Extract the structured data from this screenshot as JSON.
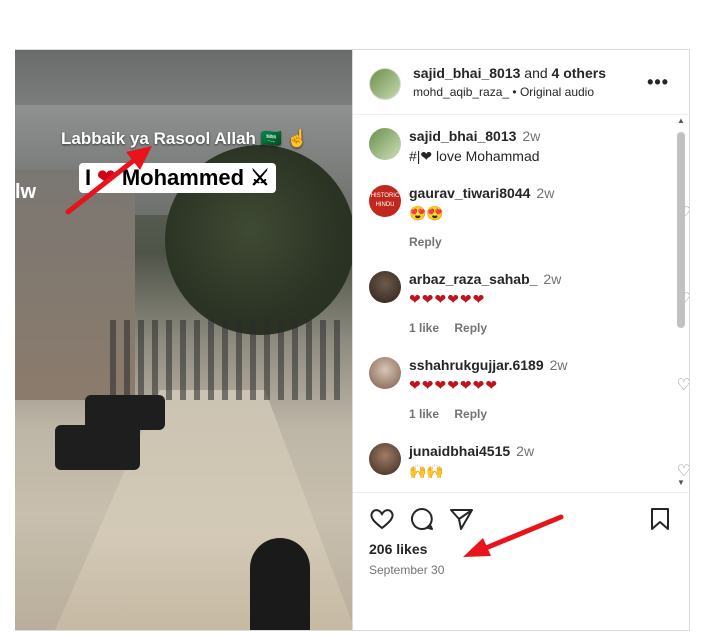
{
  "media": {
    "caption_line1": "Labbaik ya Rasool Allah 🇸🇦 ☝",
    "caption_line2_prefix": "I",
    "caption_line2_heart": "❤",
    "caption_line2_suffix": "Mohammed ⚔",
    "corner_text": "lw"
  },
  "post_header": {
    "username": "sajid_bhai_8013",
    "joiner": "and",
    "others": "4 others",
    "audio_user": "mohd_aqib_raza_",
    "audio_separator": "•",
    "audio_label": "Original audio",
    "more_label": "•••"
  },
  "comments": [
    {
      "user": "sajid_bhai_8013",
      "time": "2w",
      "text": "#|❤ love Mohammad",
      "likes": "",
      "reply": ""
    },
    {
      "user": "gaurav_tiwari8044",
      "time": "2w",
      "text": "😍😍",
      "likes": "",
      "reply": "Reply"
    },
    {
      "user": "arbaz_raza_sahab_",
      "time": "2w",
      "text": "❤❤❤❤❤❤",
      "likes": "1 like",
      "reply": "Reply"
    },
    {
      "user": "sshahrukgujjar.6189",
      "time": "2w",
      "text": "❤❤❤❤❤❤❤",
      "likes": "1 like",
      "reply": "Reply"
    },
    {
      "user": "junaidbhai4515",
      "time": "2w",
      "text": "🙌🙌",
      "likes": "",
      "reply": ""
    }
  ],
  "avatar_labels": {
    "historic_hindu": "HISTORIC HINDU"
  },
  "post_footer": {
    "likes": "206 likes",
    "date": "September 30"
  },
  "colors": {
    "annotation_arrow": "#e8131b",
    "heart": "#c1121f"
  }
}
